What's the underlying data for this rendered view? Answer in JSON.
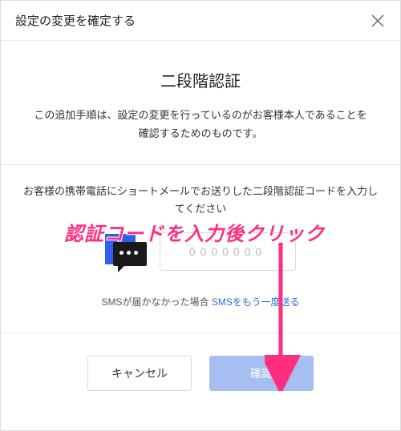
{
  "header": {
    "title": "設定の変更を確定する"
  },
  "intro": {
    "heading": "二段階認証",
    "description": "この追加手順は、設定の変更を行っているのがお客様本人であることを確認するためのものです。"
  },
  "code_section": {
    "prompt": "お客様の携帯電話にショートメールでお送りした二段階認証コードを入力してください",
    "placeholder": "0000000",
    "resend_label": "SMSが届かなかった場合 ",
    "resend_link": "SMSをもう一度送る"
  },
  "footer": {
    "cancel": "キャンセル",
    "confirm": "確認"
  },
  "annotation": {
    "text": "認証コードを入力後クリック"
  },
  "colors": {
    "accent": "#2f5ef0",
    "annotation": "#ff2e7e",
    "confirm_btn": "#a6bff0"
  }
}
